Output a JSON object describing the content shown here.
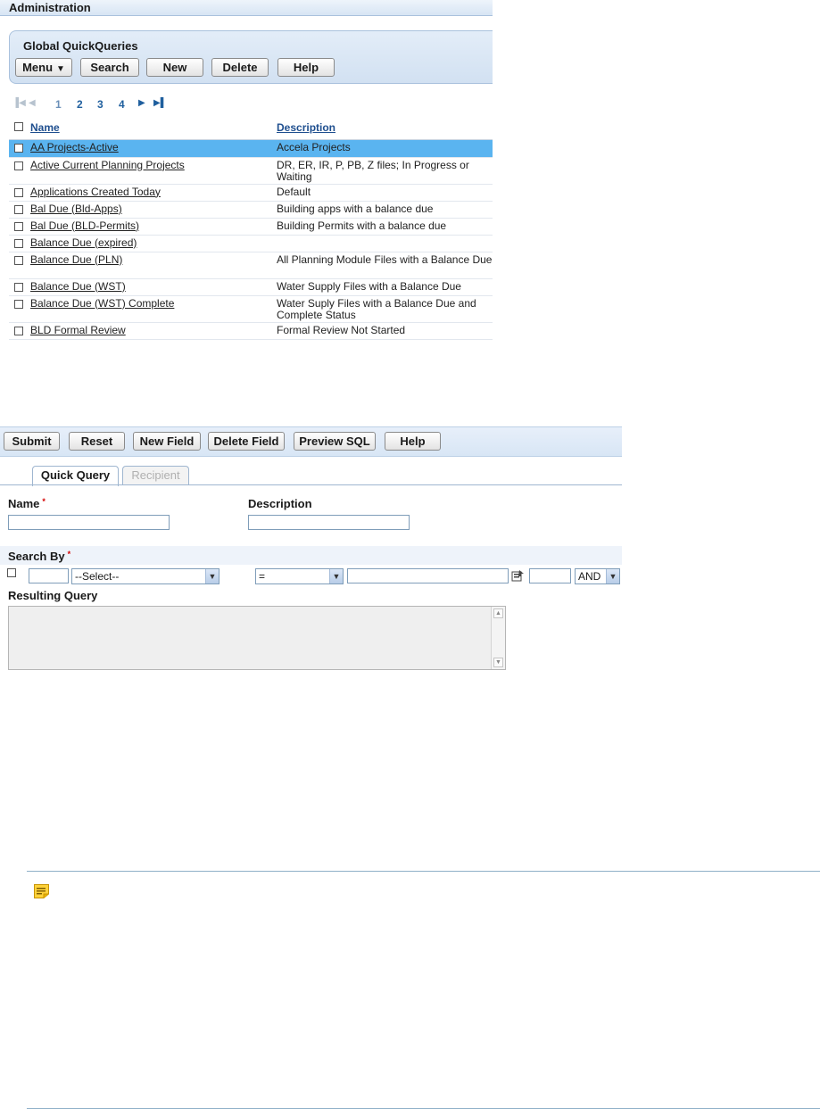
{
  "admin": {
    "title": "Administration"
  },
  "quickqueries": {
    "title": "Global QuickQueries",
    "buttons": {
      "menu": "Menu",
      "search": "Search",
      "new": "New",
      "delete": "Delete",
      "help": "Help"
    },
    "pager": {
      "pages": [
        "1",
        "2",
        "3",
        "4"
      ]
    },
    "columns": {
      "name": "Name",
      "description": "Description"
    },
    "rows": [
      {
        "name": "AA Projects-Active",
        "description": "Accela Projects"
      },
      {
        "name": "Active Current Planning Projects",
        "description": "DR, ER, IR, P, PB, Z files; In Progress or Waiting"
      },
      {
        "name": "Applications Created Today",
        "description": "Default"
      },
      {
        "name": "Bal Due (Bld-Apps)",
        "description": "Building apps with a balance due"
      },
      {
        "name": "Bal Due (BLD-Permits)",
        "description": "Building Permits with a balance due"
      },
      {
        "name": "Balance Due (expired)",
        "description": ""
      },
      {
        "name": "Balance Due (PLN)",
        "description": "All Planning Module Files with a Balance Due"
      },
      {
        "name": "Balance Due (WST)",
        "description": "Water Supply Files with a Balance Due"
      },
      {
        "name": "Balance Due (WST) Complete",
        "description": "Water Suply Files with a Balance Due and Complete Status"
      },
      {
        "name": "BLD Formal Review",
        "description": "Formal Review Not Started"
      }
    ]
  },
  "form": {
    "buttons": {
      "submit": "Submit",
      "reset": "Reset",
      "new_field": "New Field",
      "delete_field": "Delete Field",
      "preview_sql": "Preview SQL",
      "help": "Help"
    },
    "tabs": {
      "quick_query": "Quick Query",
      "recipient": "Recipient"
    },
    "name_label": "Name",
    "description_label": "Description",
    "search_by_label": "Search By",
    "required_mark": "*",
    "field_select": "--Select--",
    "operator_select": "=",
    "connector_select": "AND",
    "resulting_query_label": "Resulting Query"
  },
  "icons": {
    "select_arrow": "chevron-down-icon",
    "picker": "calendar-picker-icon",
    "note": "note-icon"
  }
}
